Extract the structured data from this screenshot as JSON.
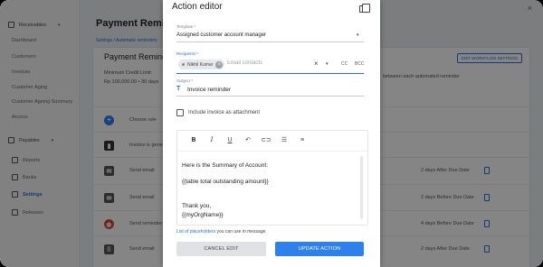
{
  "sidebar": {
    "items": [
      {
        "label": "Receivables",
        "type": "group",
        "expanded": true
      },
      {
        "label": "Dashboard",
        "type": "sub"
      },
      {
        "label": "Customers",
        "type": "sub"
      },
      {
        "label": "Invoices",
        "type": "sub"
      },
      {
        "label": "Customer Aging",
        "type": "sub"
      },
      {
        "label": "Customer Ageing Summary",
        "type": "sub"
      },
      {
        "label": "Access",
        "type": "sub"
      },
      {
        "label": "Payables",
        "type": "group",
        "expanded": true
      },
      {
        "label": "Reports",
        "type": "sub"
      },
      {
        "label": "Banks",
        "type": "sub"
      },
      {
        "label": "Settings",
        "type": "sub",
        "active": true
      },
      {
        "label": "Releases",
        "type": "sub"
      }
    ]
  },
  "main": {
    "page_title": "Payment Reminders",
    "breadcrumb": "Settings  /  Automatic reminders",
    "close_glyph": "×",
    "card": {
      "title": "Payment Reminders",
      "edit_workflow_label": "EDIT WORKFLOW SETTINGS",
      "min_credit_label": "Minimum Credit Limit:",
      "min_credit_value": "Rp 100,000.00  •  30 days",
      "right_note": "between each automated reminder",
      "rows": [
        {
          "icon": "plus-icon",
          "icon_char": "+",
          "color": "#2f80ed",
          "shape": "circle",
          "label": "Choose rule",
          "right": ""
        },
        {
          "icon": "document-icon",
          "icon_char": "▮",
          "color": "#333333",
          "shape": "square",
          "label": "Invoice is generated",
          "right": ""
        },
        {
          "icon": "email-icon",
          "icon_char": "✉",
          "color": "#555555",
          "shape": "square",
          "label": "Send email",
          "right": "2 days After Due Date"
        },
        {
          "icon": "email-icon",
          "icon_char": "✉",
          "color": "#555555",
          "shape": "square",
          "label": "Send email",
          "right": "2 days Before Due Date"
        },
        {
          "icon": "alarm-icon",
          "icon_char": "⏰",
          "color": "#e74c3c",
          "shape": "circle",
          "label": "Send reminder",
          "right": "4 days Before Due Date"
        },
        {
          "icon": "grid-icon",
          "icon_char": "⠿",
          "color": "#555555",
          "shape": "square",
          "label": "Send email",
          "right": "2 days After Due Date"
        }
      ]
    }
  },
  "modal": {
    "title": "Action editor",
    "fields": {
      "template_label": "Template *",
      "template_value": "Assigned customer account manager",
      "recipients_label": "Recipients *",
      "chip_label": "Nikhil Kumar",
      "email_placeholder": "Email contacts",
      "clear_glyph": "×",
      "caret_glyph": "▾",
      "cc_label": "CC",
      "bcc_label": "BCC",
      "subject_label": "Subject *",
      "subject_prefix": "T",
      "subject_value": "Invoice reminder",
      "attachment_label": "Include invoice as attachment"
    },
    "editor": {
      "toolbar": [
        {
          "name": "bold-icon",
          "glyph": "B"
        },
        {
          "name": "italic-icon",
          "glyph": "I"
        },
        {
          "name": "underline-icon",
          "glyph": "U"
        },
        {
          "name": "undo-icon",
          "glyph": "↶"
        },
        {
          "name": "link-icon",
          "glyph": "⊂⊃"
        },
        {
          "name": "numbered-list-icon",
          "glyph": "☰"
        },
        {
          "name": "bullet-list-icon",
          "glyph": "≡"
        }
      ],
      "lines": [
        "Here is the Summary of Account:",
        "{{table total outstanding amount}}",
        "",
        "Thank you,",
        "{{myOrgName}}"
      ]
    },
    "placeholders_link": "List of placeholders",
    "placeholders_rest": " you can use in message",
    "cancel_label": "CANCEL EDIT",
    "update_label": "UPDATE ACTION"
  },
  "colors": {
    "accent": "#2f80ed",
    "link": "#2a6ed6",
    "overlay": "rgba(0,0,0,0.48)"
  }
}
